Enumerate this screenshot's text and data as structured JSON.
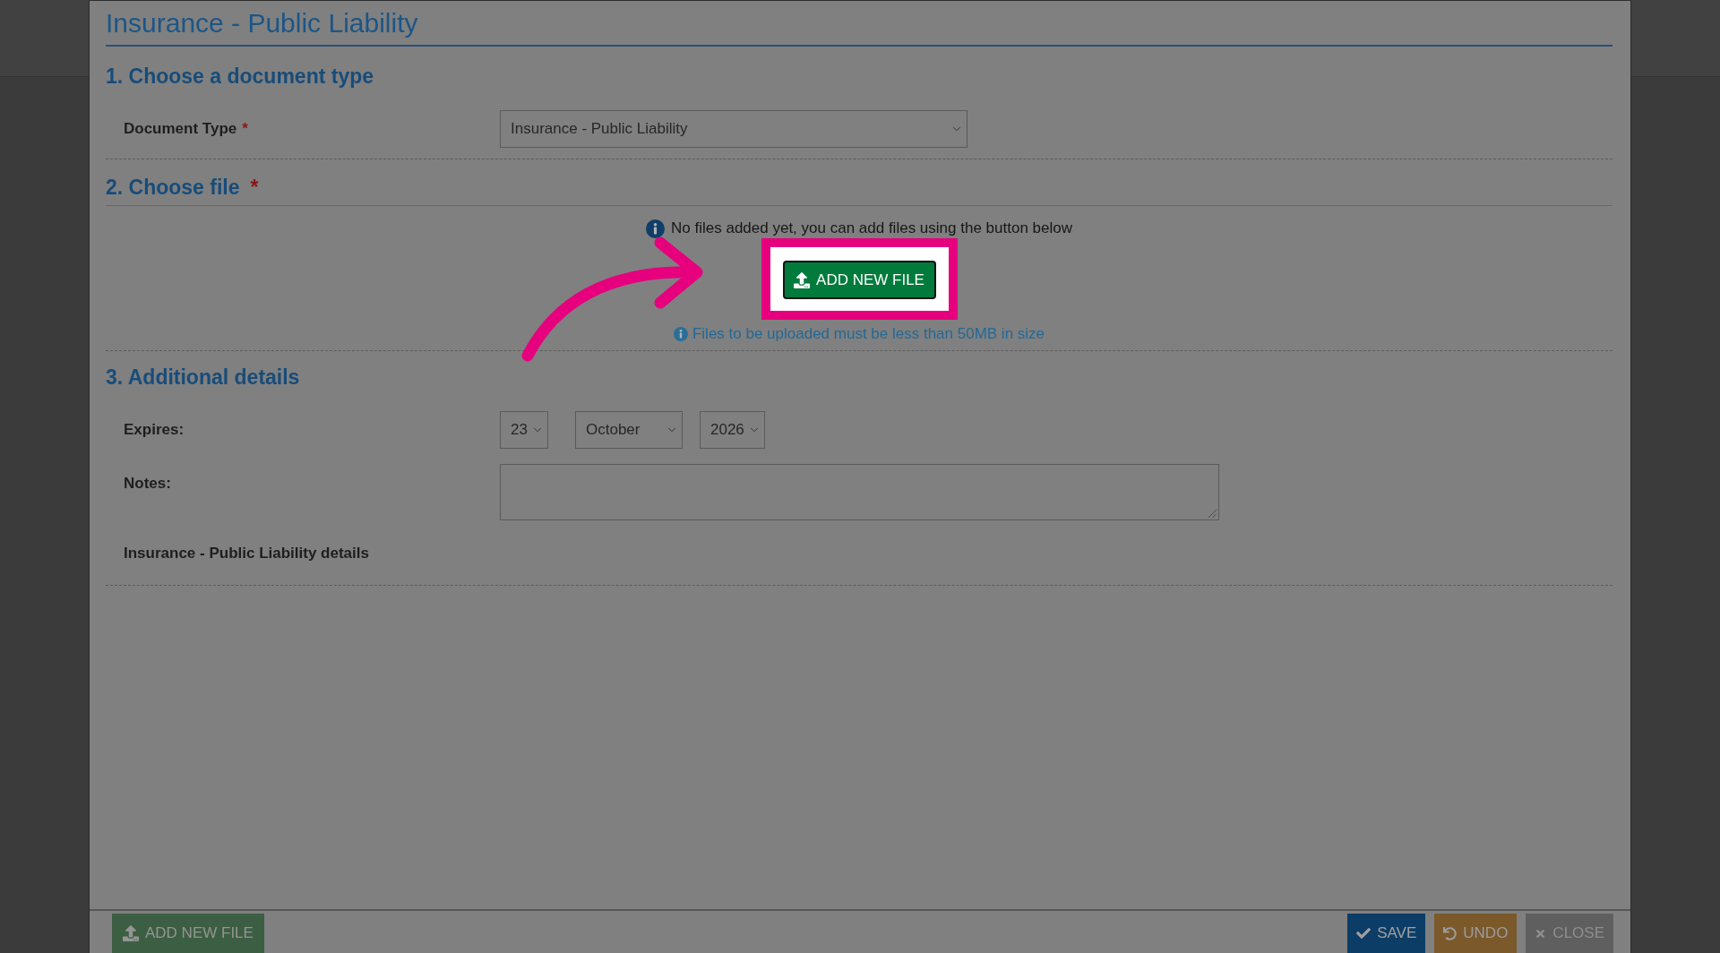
{
  "dialog": {
    "title": "Insurance - Public Liability"
  },
  "document_type_section": {
    "heading": "1. Choose a document type",
    "label": "Document Type",
    "required_mark": "*",
    "value": "Insurance - Public Liability"
  },
  "file_section": {
    "heading": "2. Choose file",
    "required_mark": "*",
    "empty_message": "No files added yet, you can add files using the button below",
    "add_button": {
      "label": "ADD NEW FILE",
      "highlighted": true
    },
    "size_note": "Files to be uploaded must be less than 50MB in size"
  },
  "details_section": {
    "heading": "3. Additional details",
    "expires": {
      "label": "Expires:",
      "day": "23",
      "month": "October",
      "year": "2026"
    },
    "notes": {
      "label": "Notes:"
    },
    "subheading": "Insurance - Public Liability details"
  },
  "footer": {
    "left_buttons": [
      {
        "kind": "add",
        "label": "ADD NEW FILE"
      }
    ],
    "right_buttons": [
      {
        "kind": "save",
        "label": "SAVE"
      },
      {
        "kind": "undo",
        "label": "UNDO"
      },
      {
        "kind": "close",
        "label": "CLOSE"
      }
    ]
  }
}
